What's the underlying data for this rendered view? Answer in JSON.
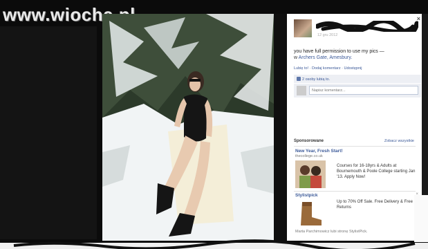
{
  "site": {
    "logo": "www.wiocha.pl"
  },
  "post": {
    "date": "12 gru 2012",
    "caption": "you have full permission to use my pics —",
    "place_prefix": "w",
    "place": "Archers Gate, Amesbury.",
    "actions": [
      "Lubię to!",
      "Dodaj komentarz",
      "Udostępnij"
    ],
    "likes": "2 osoby lubią to.",
    "comment_placeholder": "Napisz komentarz..."
  },
  "close_label": "×",
  "sponsored": {
    "heading": "Sponsorowane",
    "see_all": "Zobacz wszystkie",
    "ads": [
      {
        "title": "New Year, Fresh Start!",
        "domain": "thecollege.co.uk",
        "text": "Courses for 16-18yrs & Adults at Bournemouth & Poole College starting Jan '13. Apply Now!"
      },
      {
        "title": "Stylistpick",
        "text": "Up to 70% Off Sale. Free Delivery & Free Returns",
        "social": "Marta Parchimowicz lubi stronę StylistPick."
      }
    ]
  },
  "colors": {
    "facebook_link": "#3b5998",
    "panel_bg": "#ffffff",
    "page_bg": "#0b0b0b"
  }
}
